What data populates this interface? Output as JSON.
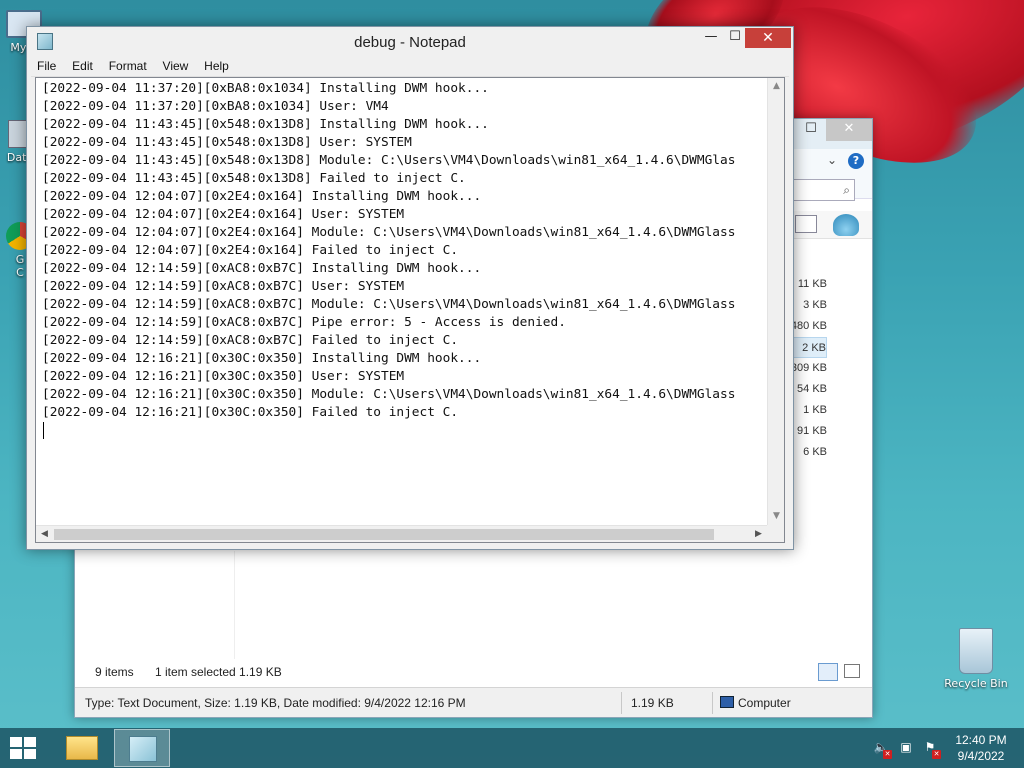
{
  "desktop": {
    "icons": [
      {
        "label": "My C"
      },
      {
        "label": "Data"
      },
      {
        "label": "G\nC"
      },
      {
        "label": "Recycle Bin"
      }
    ]
  },
  "explorer": {
    "sizes": [
      "11 KB",
      "3 KB",
      "480 KB",
      "2 KB",
      "309 KB",
      "54 KB",
      "1 KB",
      "91 KB",
      "6 KB"
    ],
    "selected_index": 3,
    "status_items": "9 items",
    "status_selected": "1 item selected  1.19 KB",
    "detail_type": "Type: Text Document, Size: 1.19 KB, Date modified: 9/4/2022 12:16 PM",
    "detail_size": "1.19 KB",
    "detail_location": "Computer",
    "close_glyph": "✕",
    "max_glyph": "☐",
    "chevron_glyph": "⌄",
    "help_glyph": "?",
    "search_glyph": "⌕"
  },
  "notepad": {
    "title": "debug - Notepad",
    "min_glyph": "—",
    "max_glyph": "☐",
    "close_glyph": "✕",
    "menu": [
      "File",
      "Edit",
      "Format",
      "View",
      "Help"
    ],
    "lines": [
      "[2022-09-04 11:37:20][0xBA8:0x1034] Installing DWM hook...",
      "[2022-09-04 11:37:20][0xBA8:0x1034] User: VM4",
      "[2022-09-04 11:43:45][0x548:0x13D8] Installing DWM hook...",
      "[2022-09-04 11:43:45][0x548:0x13D8] User: SYSTEM",
      "[2022-09-04 11:43:45][0x548:0x13D8] Module: C:\\Users\\VM4\\Downloads\\win81_x64_1.4.6\\DWMGlas",
      "[2022-09-04 11:43:45][0x548:0x13D8] Failed to inject C.",
      "[2022-09-04 12:04:07][0x2E4:0x164] Installing DWM hook...",
      "[2022-09-04 12:04:07][0x2E4:0x164] User: SYSTEM",
      "[2022-09-04 12:04:07][0x2E4:0x164] Module: C:\\Users\\VM4\\Downloads\\win81_x64_1.4.6\\DWMGlass",
      "[2022-09-04 12:04:07][0x2E4:0x164] Failed to inject C.",
      "[2022-09-04 12:14:59][0xAC8:0xB7C] Installing DWM hook...",
      "[2022-09-04 12:14:59][0xAC8:0xB7C] User: SYSTEM",
      "[2022-09-04 12:14:59][0xAC8:0xB7C] Module: C:\\Users\\VM4\\Downloads\\win81_x64_1.4.6\\DWMGlass",
      "[2022-09-04 12:14:59][0xAC8:0xB7C] Pipe error: 5 - Access is denied.",
      "[2022-09-04 12:14:59][0xAC8:0xB7C] Failed to inject C.",
      "[2022-09-04 12:16:21][0x30C:0x350] Installing DWM hook...",
      "[2022-09-04 12:16:21][0x30C:0x350] User: SYSTEM",
      "[2022-09-04 12:16:21][0x30C:0x350] Module: C:\\Users\\VM4\\Downloads\\win81_x64_1.4.6\\DWMGlass",
      "[2022-09-04 12:16:21][0x30C:0x350] Failed to inject C."
    ],
    "scroll_up": "▲",
    "scroll_down": "▼",
    "scroll_left": "◀",
    "scroll_right": "▶"
  },
  "taskbar": {
    "clock_time": "12:40 PM",
    "clock_date": "9/4/2022",
    "tray_icons": [
      "volume-muted-icon",
      "network-error-icon",
      "action-center-error-icon"
    ],
    "tray_glyphs": [
      "🔈",
      "▣",
      "⚑"
    ],
    "tray_x": "✕"
  }
}
